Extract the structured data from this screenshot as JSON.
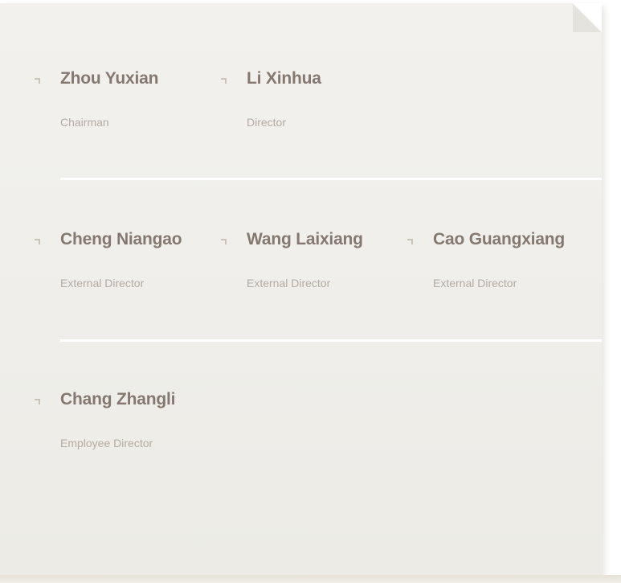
{
  "board": {
    "rows": [
      {
        "members": [
          {
            "name": "Zhou Yuxian",
            "role": "Chairman"
          },
          {
            "name": "Li Xinhua",
            "role": "Director"
          }
        ]
      },
      {
        "members": [
          {
            "name": "Cheng Niangao",
            "role": "External Director"
          },
          {
            "name": "Wang Laixiang",
            "role": "External Director"
          },
          {
            "name": "Cao Guangxiang",
            "role": "External Director"
          }
        ]
      },
      {
        "members": [
          {
            "name": "Chang Zhangli",
            "role": "Employee Director"
          }
        ]
      }
    ]
  },
  "colors": {
    "name": "#857870",
    "role": "#b3aca3",
    "bullet": "#c9c2b8",
    "background": "#f0efeb"
  },
  "icons": {
    "bullet": "corner-arrow-icon",
    "fold": "page-fold-icon"
  }
}
